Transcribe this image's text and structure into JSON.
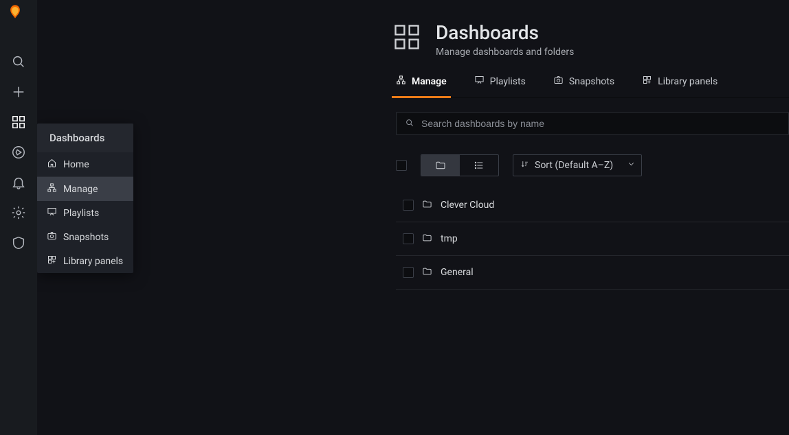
{
  "iconbar": {
    "logo_color_main": "#f46800",
    "logo_color_alt": "#fbbf3a",
    "active_section": "dashboards"
  },
  "flyout": {
    "title": "Dashboards",
    "items": [
      {
        "label": "Home",
        "icon": "home-icon",
        "active": false
      },
      {
        "label": "Manage",
        "icon": "sitemap-icon",
        "active": true
      },
      {
        "label": "Playlists",
        "icon": "presentation-icon",
        "active": false
      },
      {
        "label": "Snapshots",
        "icon": "camera-icon",
        "active": false
      },
      {
        "label": "Library panels",
        "icon": "library-icon",
        "active": false
      }
    ]
  },
  "page": {
    "title": "Dashboards",
    "subtitle": "Manage dashboards and folders"
  },
  "tabs": [
    {
      "label": "Manage",
      "icon": "sitemap-icon",
      "active": true
    },
    {
      "label": "Playlists",
      "icon": "presentation-icon",
      "active": false
    },
    {
      "label": "Snapshots",
      "icon": "camera-icon",
      "active": false
    },
    {
      "label": "Library panels",
      "icon": "library-icon",
      "active": false
    }
  ],
  "search": {
    "placeholder": "Search dashboards by name",
    "value": ""
  },
  "view": {
    "mode": "folders",
    "sort_label": "Sort (Default A–Z)"
  },
  "folders": [
    {
      "name": "Clever Cloud"
    },
    {
      "name": "tmp"
    },
    {
      "name": "General"
    }
  ]
}
